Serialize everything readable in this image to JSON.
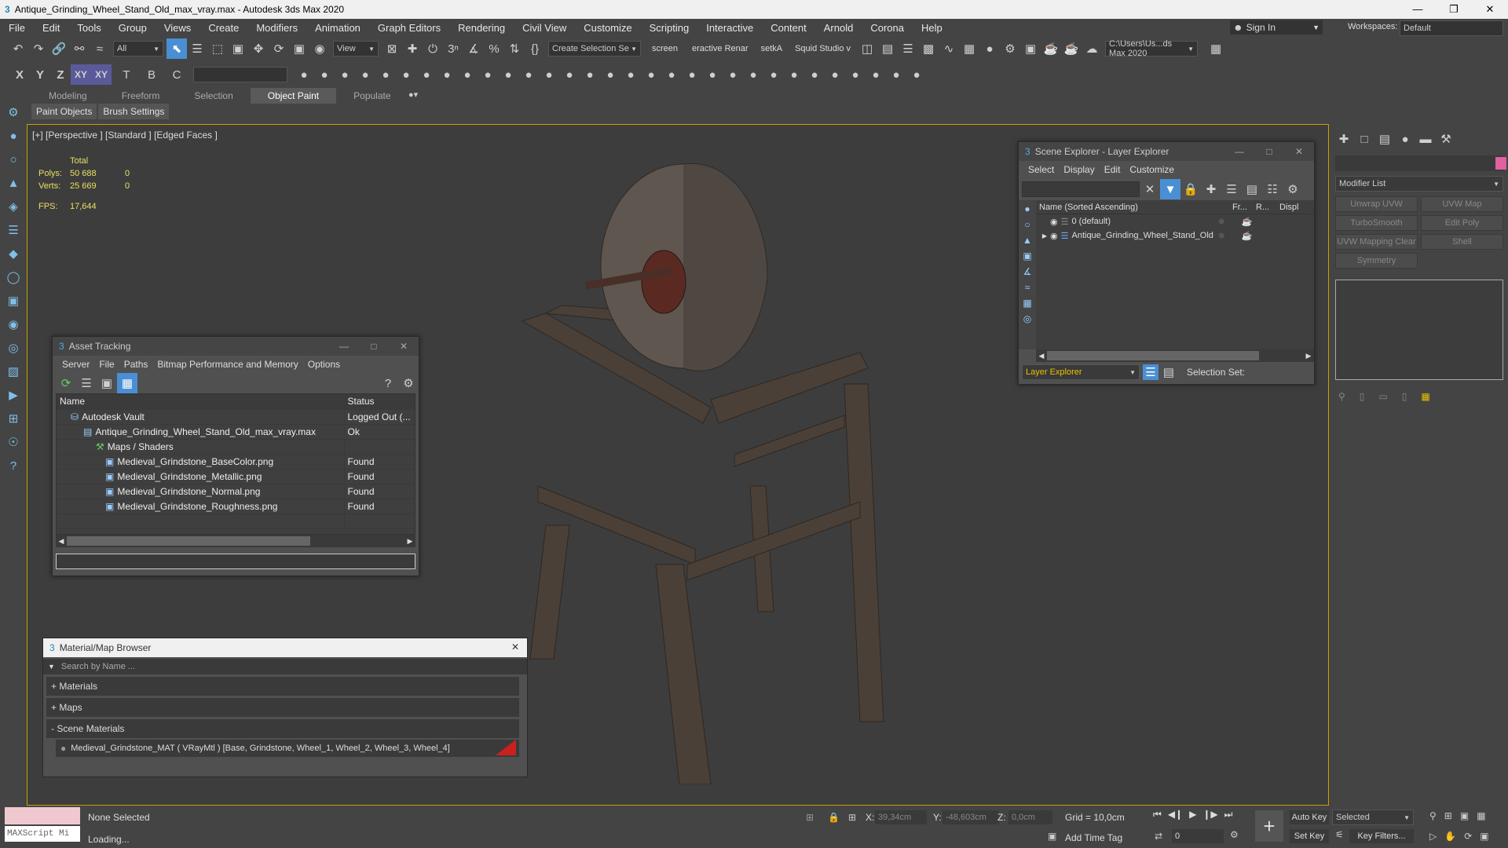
{
  "window": {
    "title": "Antique_Grinding_Wheel_Stand_Old_max_vray.max - Autodesk 3ds Max 2020"
  },
  "menu": [
    "File",
    "Edit",
    "Tools",
    "Group",
    "Views",
    "Create",
    "Modifiers",
    "Animation",
    "Graph Editors",
    "Rendering",
    "Civil View",
    "Customize",
    "Scripting",
    "Interactive",
    "Content",
    "Arnold",
    "Corona",
    "Help"
  ],
  "signin": {
    "label": "Sign In",
    "workspaces_label": "Workspaces:",
    "workspace": "Default"
  },
  "toolbar": {
    "filter": "All",
    "view": "View",
    "create_selection_set": "Create Selection Se",
    "screen": "screen",
    "interactive_render": "eractive Renar",
    "setka": "setkA",
    "squid": "Squid Studio v",
    "path": "C:\\Users\\Us...ds Max 2020"
  },
  "axes": [
    "X",
    "Y",
    "Z",
    "XY",
    "XY"
  ],
  "ribbon_tabs": [
    "Modeling",
    "Freeform",
    "Selection",
    "Object Paint",
    "Populate"
  ],
  "ribbon_active": "Object Paint",
  "ribbon_subtabs": [
    "Paint Objects",
    "Brush Settings"
  ],
  "viewport": {
    "label": "[+] [Perspective ] [Standard ] [Edged Faces ]",
    "total_label": "Total",
    "polys_label": "Polys:",
    "polys": "50 688",
    "polys_sel": "0",
    "verts_label": "Verts:",
    "verts": "25 669",
    "verts_sel": "0",
    "fps_label": "FPS:",
    "fps": "17,644"
  },
  "asset_tracking": {
    "title": "Asset Tracking",
    "menu": [
      "Server",
      "File",
      "Paths",
      "Bitmap Performance and Memory",
      "Options"
    ],
    "col_name": "Name",
    "col_status": "Status",
    "rows": [
      {
        "name": "Autodesk Vault",
        "status": "Logged Out (..."
      },
      {
        "name": "Antique_Grinding_Wheel_Stand_Old_max_vray.max",
        "status": "Ok"
      },
      {
        "name": "Maps / Shaders",
        "status": ""
      },
      {
        "name": "Medieval_Grindstone_BaseColor.png",
        "status": "Found"
      },
      {
        "name": "Medieval_Grindstone_Metallic.png",
        "status": "Found"
      },
      {
        "name": "Medieval_Grindstone_Normal.png",
        "status": "Found"
      },
      {
        "name": "Medieval_Grindstone_Roughness.png",
        "status": "Found"
      }
    ]
  },
  "scene_explorer": {
    "title": "Scene Explorer - Layer Explorer",
    "menu": [
      "Select",
      "Display",
      "Edit",
      "Customize"
    ],
    "col_name": "Name (Sorted Ascending)",
    "col_fr": "Fr...",
    "col_r": "R...",
    "col_disp": "Displ",
    "rows": [
      {
        "name": "0 (default)"
      },
      {
        "name": "Antique_Grinding_Wheel_Stand_Old"
      }
    ],
    "layer_explorer": "Layer Explorer",
    "selection_set": "Selection Set:"
  },
  "material_browser": {
    "title": "Material/Map Browser",
    "search_placeholder": "Search by Name ...",
    "groups": [
      "+ Materials",
      "+ Maps",
      "- Scene Materials"
    ],
    "material": "Medieval_Grindstone_MAT  ( VRayMtl )  [Base, Grindstone, Wheel_1, Wheel_2, Wheel_3, Wheel_4]"
  },
  "modifier_panel": {
    "modifier_list": "Modifier List",
    "buttons": [
      "Unwrap UVW",
      "UVW Map",
      "TurboSmooth",
      "Edit Poly",
      "UVW Mapping Clear",
      "Shell",
      "Symmetry"
    ]
  },
  "status": {
    "maxscript": "MAXScript Mi",
    "none_selected": "None Selected",
    "loading": "Loading...",
    "x_label": "X:",
    "x": "39,34cm",
    "y_label": "Y:",
    "y": "-48,603cm",
    "z_label": "Z:",
    "z": "0,0cm",
    "grid": "Grid = 10,0cm",
    "add_time_tag": "Add Time Tag",
    "auto_key": "Auto Key",
    "set_key": "Set Key",
    "selected": "Selected",
    "key_filters": "Key Filters...",
    "frame": "0"
  },
  "colors": {
    "accent": "#4a8fd4",
    "viewport_border": "#c8a000",
    "found": "#eeeeee"
  }
}
